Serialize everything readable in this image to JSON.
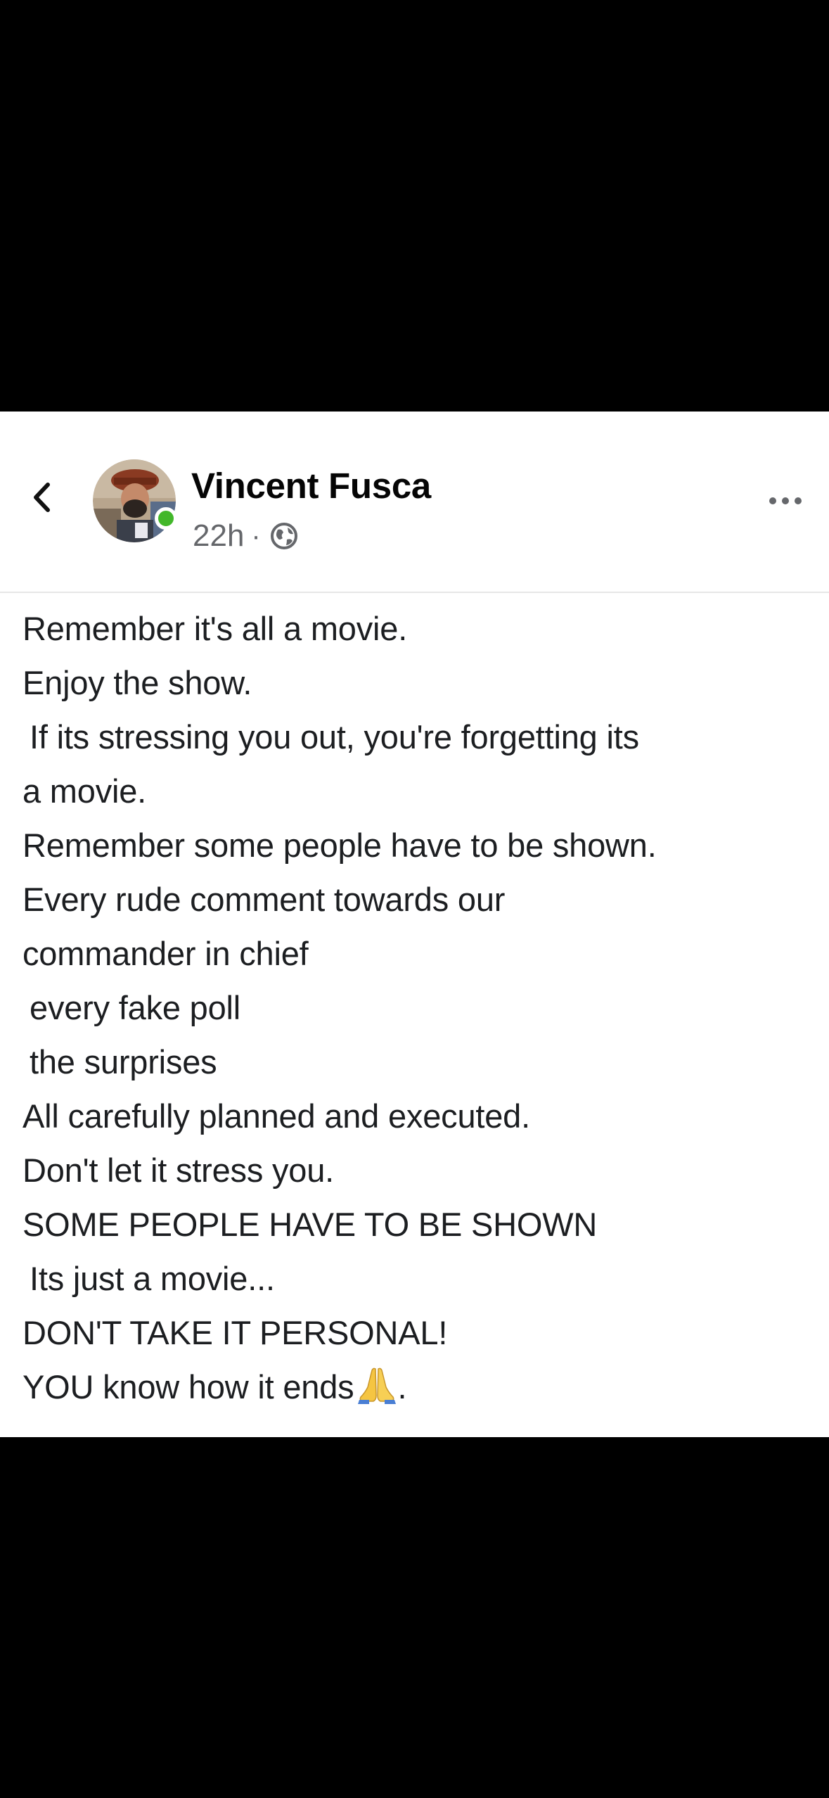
{
  "post": {
    "author_name": "Vincent Fusca",
    "timestamp": "22h",
    "separator": "·",
    "privacy_icon": "globe-icon",
    "back_icon": "chevron-left-icon",
    "more_icon": "more-horizontal-icon",
    "online_status_color": "#42b72a",
    "lines": [
      "Remember it's all a movie.",
      "Enjoy the show.",
      " If its stressing you out, you're forgetting its",
      "a movie.",
      "Remember some people have to be shown.",
      "Every rude comment towards our",
      "commander in chief",
      " every fake poll",
      " the surprises",
      "All carefully planned and executed.",
      "Don't let it stress you.",
      "SOME PEOPLE HAVE TO BE SHOWN",
      " Its just a movie...",
      "DON'T TAKE IT PERSONAL!",
      "YOU know how it ends"
    ],
    "last_line_suffix": ".",
    "last_line_emoji": "praying-hands-emoji"
  }
}
